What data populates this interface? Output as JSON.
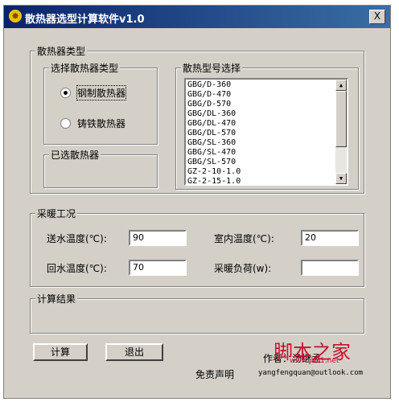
{
  "window": {
    "title": "散热器选型计算软件v1.0",
    "close_label": "X"
  },
  "radiator_type": {
    "group_label": "散热器类型",
    "choose_label": "选择散热器类型",
    "options": [
      "钢制散热器",
      "铸铁散热器"
    ],
    "selected_option": "钢制散热器",
    "selected_group_label": "已选散热器"
  },
  "model_select": {
    "group_label": "散热型号选择",
    "items": [
      "GBG/D-360",
      "GBG/D-470",
      "GBG/D-570",
      "GBG/DL-360",
      "GBG/DL-470",
      "GBG/DL-570",
      "GBG/SL-360",
      "GBG/SL-470",
      "GBG/SL-570",
      "GZ-2-10-1.0",
      "GZ-2-15-1.0"
    ]
  },
  "heating": {
    "group_label": "采暖工况",
    "supply_temp_label": "送水温度(℃):",
    "supply_temp_value": "90",
    "room_temp_label": "室内温度(℃):",
    "room_temp_value": "20",
    "return_temp_label": "回水温度(℃):",
    "return_temp_value": "70",
    "load_label": "采暖负荷(w):",
    "load_value": ""
  },
  "result": {
    "group_label": "计算结果"
  },
  "buttons": {
    "calculate": "计算",
    "exit": "退出"
  },
  "footer": {
    "author": "作者：汤继孟",
    "email": "yangfengquan@outlook.com",
    "disclaimer": "免责声明",
    "watermark": "脚本之家",
    "watermark_url": "www.jb51.net"
  }
}
